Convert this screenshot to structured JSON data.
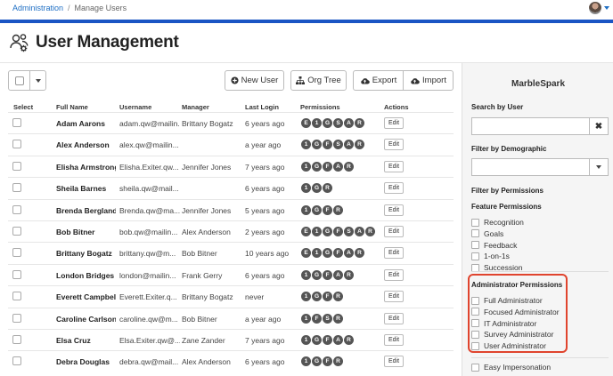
{
  "breadcrumb": {
    "root": "Administration",
    "separator": "/",
    "current": "Manage Users"
  },
  "page": {
    "title": "User Management"
  },
  "toolbar": {
    "new_user": "New User",
    "org_tree": "Org Tree",
    "export": "Export",
    "import": "Import"
  },
  "table": {
    "headers": [
      "Select",
      "Full Name",
      "Username",
      "Manager",
      "Last Login",
      "Permissions",
      "Actions"
    ],
    "edit_label": "Edit",
    "rows": [
      {
        "name": "Adam Aarons",
        "username": "adam.qw@mailin...",
        "manager": "Brittany Bogatz",
        "last_login": "6 years ago",
        "perms": [
          "E",
          "1",
          "G",
          "S",
          "A",
          "R"
        ]
      },
      {
        "name": "Alex Anderson",
        "username": "alex.qw@mailin...",
        "manager": "",
        "last_login": "a year ago",
        "perms": [
          "1",
          "G",
          "F",
          "S",
          "A",
          "R"
        ]
      },
      {
        "name": "Elisha Armstrong",
        "username": "Elisha.Exiter.qw...",
        "manager": "Jennifer Jones",
        "last_login": "7 years ago",
        "perms": [
          "1",
          "G",
          "F",
          "A",
          "R"
        ]
      },
      {
        "name": "Sheila Barnes",
        "username": "sheila.qw@mail...",
        "manager": "",
        "last_login": "6 years ago",
        "perms": [
          "1",
          "G",
          "R"
        ]
      },
      {
        "name": "Brenda Bergland",
        "username": "Brenda.qw@ma...",
        "manager": "Jennifer Jones",
        "last_login": "5 years ago",
        "perms": [
          "1",
          "G",
          "F",
          "R"
        ]
      },
      {
        "name": "Bob Bitner",
        "username": "bob.qw@mailin...",
        "manager": "Alex Anderson",
        "last_login": "2 years ago",
        "perms": [
          "E",
          "1",
          "G",
          "F",
          "S",
          "A",
          "R"
        ]
      },
      {
        "name": "Brittany Bogatz",
        "username": "brittany.qw@m...",
        "manager": "Bob Bitner",
        "last_login": "10 years ago",
        "perms": [
          "E",
          "1",
          "G",
          "F",
          "A",
          "R"
        ]
      },
      {
        "name": "London Bridges",
        "username": "london@mailin...",
        "manager": "Frank Gerry",
        "last_login": "6 years ago",
        "perms": [
          "1",
          "G",
          "F",
          "A",
          "R"
        ]
      },
      {
        "name": "Everett Campbell",
        "username": "Everett.Exiter.q...",
        "manager": "Brittany Bogatz",
        "last_login": "never",
        "perms": [
          "1",
          "G",
          "F",
          "R"
        ]
      },
      {
        "name": "Caroline Carlson",
        "username": "caroline.qw@m...",
        "manager": "Bob Bitner",
        "last_login": "a year ago",
        "perms": [
          "1",
          "F",
          "S",
          "R"
        ]
      },
      {
        "name": "Elsa Cruz",
        "username": "Elsa.Exiter.qw@...",
        "manager": "Zane Zander",
        "last_login": "7 years ago",
        "perms": [
          "1",
          "G",
          "F",
          "A",
          "R"
        ]
      },
      {
        "name": "Debra Douglas",
        "username": "debra.qw@mail...",
        "manager": "Alex Anderson",
        "last_login": "6 years ago",
        "perms": [
          "1",
          "G",
          "F",
          "R"
        ]
      }
    ]
  },
  "panel": {
    "brand": "MarbleSpark",
    "search_label": "Search by User",
    "demographic_label": "Filter by Demographic",
    "permissions_label": "Filter by Permissions",
    "feature_label": "Feature Permissions",
    "feature_options": [
      "Recognition",
      "Goals",
      "Feedback",
      "1-on-1s",
      "Succession"
    ],
    "admin_label": "Administrator Permissions",
    "admin_options": [
      "Full Administrator",
      "Focused Administrator",
      "IT Administrator",
      "Survey Administrator",
      "User Administrator"
    ],
    "extra_option": "Easy Impersonation"
  },
  "colors": {
    "accent": "#1a55c4",
    "badge": "#555555",
    "highlight": "#e0442e"
  }
}
